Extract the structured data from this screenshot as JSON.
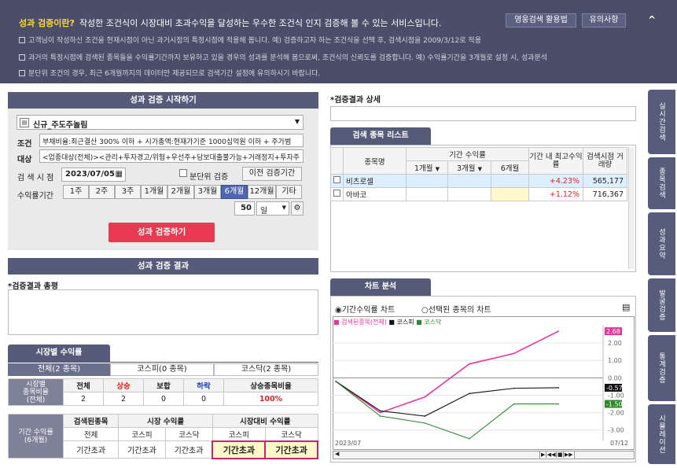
{
  "info": {
    "title": "성과 검증이란?",
    "desc": "작성한 조건식이 시장대비 초과수익을 달성하는 우수한 조건식 인지 검증해 볼 수 있는 서비스입니다.",
    "btn_use": "영웅검색 활용법",
    "btn_note": "유의사항",
    "collapse": "^",
    "lines": [
      "고객님이 작성하신 조건을 현재시점이 아닌 과거시점의 특정시점에 적용해 봅니다.   예) 검증하고자 하는 조건식을 선택 후, 검색시점을 2009/3/12로 적용",
      "과거의 특정시점에 검색된 종목들을 수익률기간까지 보유하고 있을 경우의 성과를 분석해 봄으로써, 조건식의 신뢰도를 검증합니다.  예) 수익률기간을 3개월로 설정 시, 성과분석",
      "분단위 조건의 경우, 최근 6개월까지의 데이터만 제공되므로 검색기간 설정에 유의하시기 바랍니다."
    ]
  },
  "start": {
    "header": "성과 검증 시작하기",
    "condition_select": "신규_주도주놀림",
    "cond_label": "조건",
    "cond_text": "부채비율:최근결산 300% 이하 + 시가총액:현재가기준 1000십억원 이하 + 주가범",
    "target_label": "대상",
    "target_text": "<업종대상(전체)><관리+투자경고/위험+우선주+담보대출불가능+거래정지+투자주",
    "date_label": "검 색 시 점",
    "date": "2023/07/05",
    "minute_label": "분단위 검증",
    "prev_btn": "이전 검증기간",
    "period_label": "수익률기간",
    "periods": [
      "1주",
      "2주",
      "3주",
      "1개월",
      "2개월",
      "3개월",
      "6개월",
      "12개월",
      "기타"
    ],
    "active_period": "6개월",
    "custom_value": "50",
    "custom_unit": "일",
    "run_btn": "성과 검증하기"
  },
  "result": {
    "header": "성과 검증 결과",
    "summary_label": "*검증결과 총평",
    "detail_label": "*검증결과 상세"
  },
  "market": {
    "tab": "시장별 수익률",
    "subtabs": [
      "전체(2 종목)",
      "코스피(0 종목)",
      "코스닥(2 종목)"
    ],
    "ratio_label": [
      "시장별",
      "종목비율",
      "(전체)"
    ],
    "ratio_heads": [
      "전체",
      "상승",
      "보합",
      "하락",
      "상승종목비율"
    ],
    "ratio_vals": [
      "2",
      "2",
      "0",
      "0",
      "100%"
    ],
    "ret_label": [
      "기간 수익률",
      "(6개월)"
    ],
    "ret_heads": [
      "검색된종목",
      "시장 수익률",
      "시장대비 수익률"
    ],
    "ret_subheads": [
      "전체",
      "코스피",
      "코스닥",
      "코스피",
      "코스닥"
    ],
    "ret_vals": [
      "기간초과",
      "기간초과",
      "기간초과",
      "기간초과",
      "기간초과"
    ]
  },
  "list": {
    "tab": "검색 종목 리스트",
    "heads": {
      "name": "종목명",
      "period_ret": "기간 수익률",
      "m1": "1개월",
      "m3": "3개월",
      "m6": "6개월",
      "max_ret": "기간 내 최고수익률",
      "volume": "검색시점 거래량"
    },
    "rows": [
      {
        "name": "비츠로셀",
        "max": "+4.23%",
        "vol": "565,177"
      },
      {
        "name": "아바코",
        "max": "+1.12%",
        "vol": "716,367"
      }
    ]
  },
  "chart_panel": {
    "tab": "차트 분석",
    "radio1": "기간수익률 차트",
    "radio2": "선택된 종목의 차트",
    "legend": [
      "검색된종목(전체)",
      "코스피",
      "코스닥"
    ],
    "x_start": "2023/07",
    "x_end": "07/12"
  },
  "chart_data": {
    "type": "line",
    "x": [
      1,
      2,
      3,
      4,
      5,
      6,
      7
    ],
    "ylim": [
      -3.6,
      3.0
    ],
    "yticks": [
      "2.00",
      "1.00",
      "0.00",
      "-1.00",
      "-2.00",
      "-3.00"
    ],
    "series": [
      {
        "name": "검색된종목(전체)",
        "color": "#e8359c",
        "values": [
          -0.2,
          -2.0,
          -1.1,
          0.8,
          1.4,
          2.68,
          null
        ]
      },
      {
        "name": "코스피",
        "color": "#111111",
        "values": [
          -0.2,
          -1.9,
          -2.2,
          -0.9,
          -0.6,
          -0.57,
          null
        ]
      },
      {
        "name": "코스닥",
        "color": "#2c8a2c",
        "values": [
          -0.2,
          -2.2,
          -2.6,
          -3.5,
          -1.5,
          -1.5,
          null
        ]
      }
    ],
    "end_labels": [
      "2.68",
      "-0.57",
      "-1.50"
    ]
  },
  "side_tabs": [
    "실시간검색",
    "종목검색",
    "성과요약",
    "발굴검증",
    "통계검증",
    "시뮬레이션"
  ],
  "colors": {
    "header_bar": "#4a4e68",
    "accent": "#e83a50",
    "active": "#5066b0"
  }
}
